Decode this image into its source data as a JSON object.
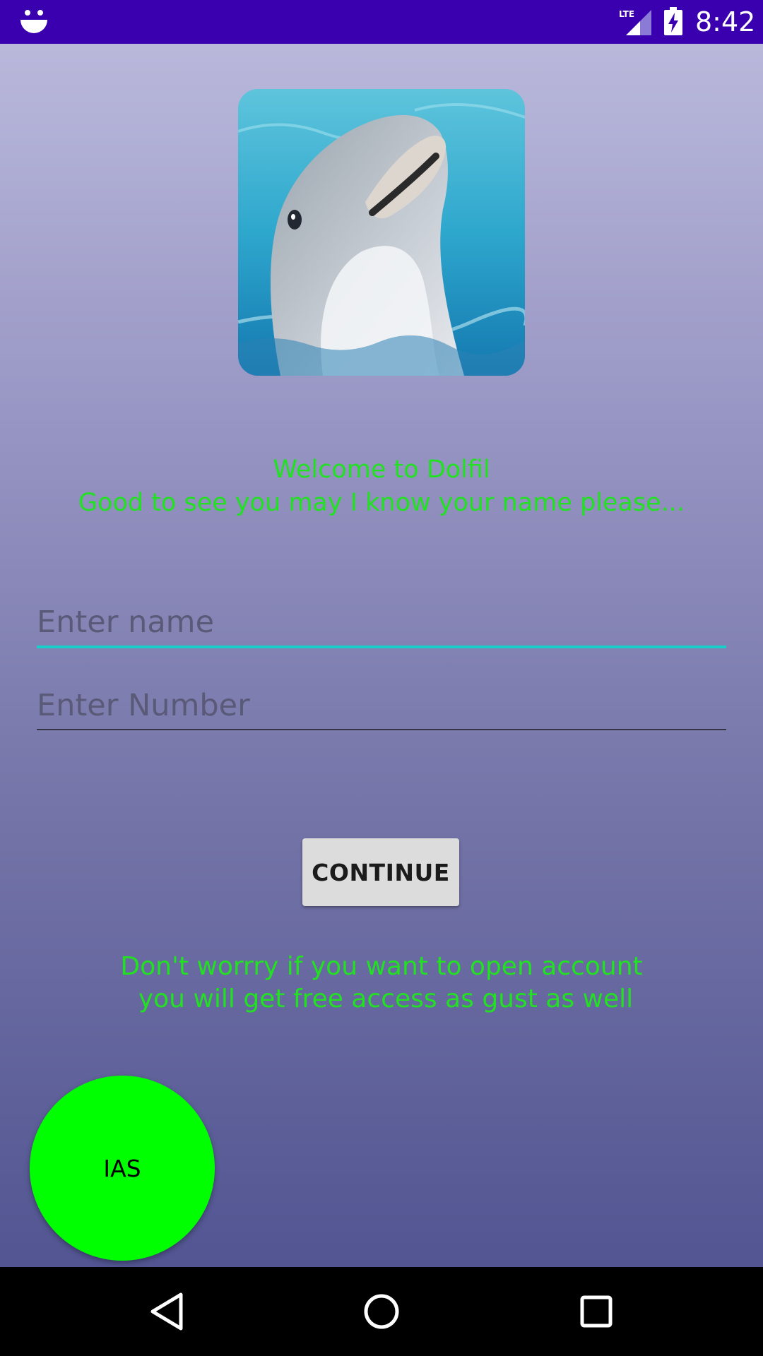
{
  "status_bar": {
    "network": "LTE",
    "time": "8:42"
  },
  "welcome": {
    "line1": "Welcome to Dolfil",
    "line2": "Good to see you may I know your name please..."
  },
  "form": {
    "name_placeholder": "Enter name",
    "number_placeholder": "Enter Number",
    "continue_label": "CONTINUE"
  },
  "info": {
    "line1": "Don't worrry if you want to open account",
    "line2": "you will get free access as gust as well"
  },
  "fab": {
    "label": "IAS"
  },
  "icons": {
    "status": [
      "smiley-icon",
      "lte-signal-icon",
      "battery-charging-icon"
    ],
    "nav": [
      "back-icon",
      "home-icon",
      "recents-icon"
    ]
  },
  "colors": {
    "status_bar": "#3a00b0",
    "accent_text": "#22e022",
    "input_focus": "#16cfc8",
    "fab": "#00ff00",
    "button": "#dcdcdc"
  }
}
